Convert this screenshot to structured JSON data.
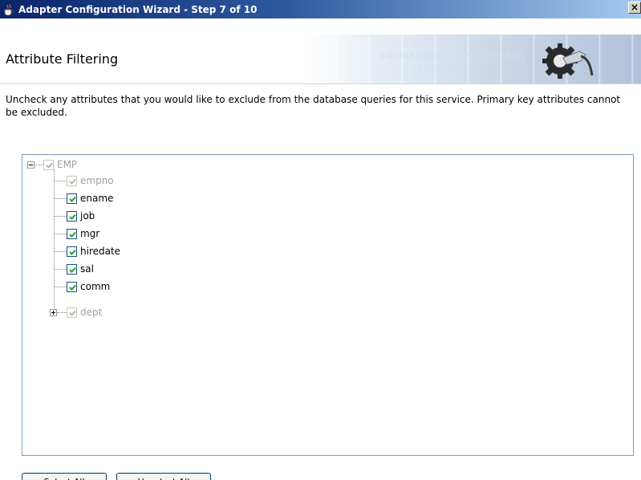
{
  "window": {
    "title": "Adapter Configuration Wizard - Step 7 of 10",
    "close_label": "×"
  },
  "header": {
    "page_title": "Attribute Filtering",
    "binary_text_1": "010101010101010101010101010101",
    "binary_text_2": "01010101010"
  },
  "instructions": "Uncheck any attributes that you would like to exclude from the database queries for this service.  Primary key attributes cannot be excluded.",
  "tree": {
    "root": {
      "label": "EMP",
      "checked": true,
      "disabled": true,
      "expanded": true
    },
    "children": [
      {
        "label": "empno",
        "checked": true,
        "disabled": true
      },
      {
        "label": "ename",
        "checked": true,
        "disabled": false
      },
      {
        "label": "job",
        "checked": true,
        "disabled": false
      },
      {
        "label": "mgr",
        "checked": true,
        "disabled": false
      },
      {
        "label": "hiredate",
        "checked": true,
        "disabled": false
      },
      {
        "label": "sal",
        "checked": true,
        "disabled": false
      },
      {
        "label": "comm",
        "checked": true,
        "disabled": false
      },
      {
        "label": "dept",
        "checked": true,
        "disabled": true,
        "expandable": true
      }
    ]
  },
  "buttons": {
    "select_all": "Select All",
    "unselect_all": "Unselect All"
  },
  "colors": {
    "titlebar_start": "#0a246a",
    "titlebar_end": "#a6caf0",
    "check_enabled": "#21a121",
    "check_disabled": "#a0c0a0"
  }
}
